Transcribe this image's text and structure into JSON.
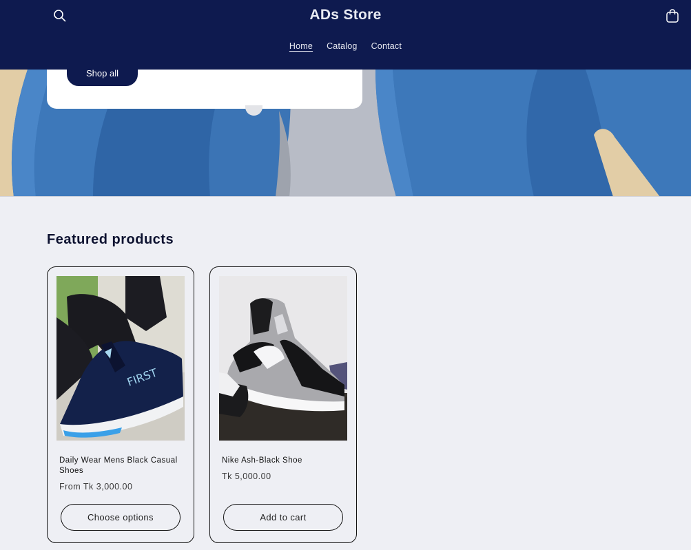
{
  "header": {
    "store_name": "ADs Store",
    "search_icon": "search-icon",
    "cart_icon": "shopping-bag-icon",
    "nav": [
      {
        "label": "Home",
        "active": true
      },
      {
        "label": "Catalog",
        "active": false
      },
      {
        "label": "Contact",
        "active": false
      }
    ]
  },
  "hero": {
    "button_label": "Shop all"
  },
  "featured": {
    "title": "Featured products",
    "products": [
      {
        "name": "Daily Wear Mens Black Casual Shoes",
        "price": "From Tk 3,000.00",
        "button_label": "Choose options"
      },
      {
        "name": "Nike Ash-Black Shoe",
        "price": "Tk 5,000.00",
        "button_label": "Add to cart"
      }
    ]
  },
  "colors": {
    "header_bg": "#0e1a4f",
    "page_bg": "#eeeff4",
    "hero_blue": "#3c76b8"
  }
}
